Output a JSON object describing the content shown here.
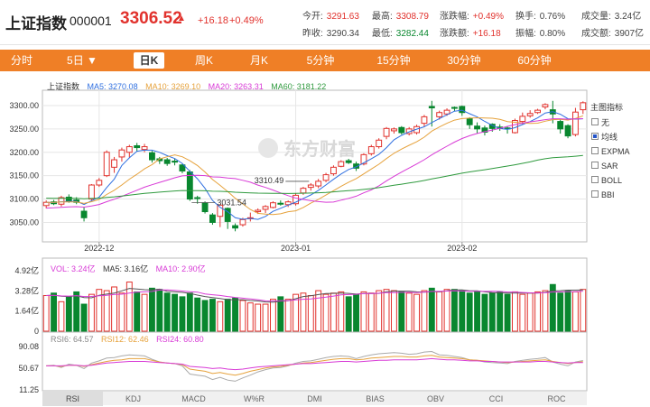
{
  "index": {
    "name": "上证指数",
    "code": "000001",
    "price": "3306.52",
    "arrow": "▲",
    "change": "+16.18",
    "change_pct": "+0.49%"
  },
  "stats": [
    {
      "label": "今开:",
      "value": "3291.63",
      "color": "red"
    },
    {
      "label": "最高:",
      "value": "3308.79",
      "color": "red"
    },
    {
      "label": "涨跌幅:",
      "value": "+0.49%",
      "color": "red"
    },
    {
      "label": "换手:",
      "value": "0.76%",
      "color": "gray"
    },
    {
      "label": "成交量:",
      "value": "3.24亿",
      "color": "gray"
    },
    {
      "label": "昨收:",
      "value": "3290.34",
      "color": "gray"
    },
    {
      "label": "最低:",
      "value": "3282.44",
      "color": "green"
    },
    {
      "label": "涨跌额:",
      "value": "+16.18",
      "color": "red"
    },
    {
      "label": "振幅:",
      "value": "0.80%",
      "color": "gray"
    },
    {
      "label": "成交额:",
      "value": "3907亿",
      "color": "gray"
    }
  ],
  "tabs": [
    "分时",
    "5日 ▼",
    "日K",
    "周K",
    "月K",
    "5分钟",
    "15分钟",
    "30分钟",
    "60分钟"
  ],
  "active_tab": "日K",
  "main_legend": {
    "name": "上证指数",
    "ma5": "MA5: 3270.08",
    "ma10": "MA10: 3269.10",
    "ma20": "MA20: 3263.31",
    "ma60": "MA60: 3181.22"
  },
  "indicator_panel": {
    "title": "主图指标",
    "items": [
      {
        "label": "无",
        "checked": false
      },
      {
        "label": "均线",
        "checked": true
      },
      {
        "label": "EXPMA",
        "checked": false
      },
      {
        "label": "SAR",
        "checked": false
      },
      {
        "label": "BOLL",
        "checked": false
      },
      {
        "label": "BBI",
        "checked": false
      }
    ]
  },
  "volume_legend": {
    "vol": "VOL: 3.24亿",
    "ma5": "MA5: 3.16亿",
    "ma10": "MA10: 2.90亿"
  },
  "rsi_legend": {
    "rsi6": "RSI6: 64.57",
    "rsi12": "RSI12: 62.46",
    "rsi24": "RSI24: 60.80"
  },
  "bottom_tabs": [
    "RSI",
    "KDJ",
    "MACD",
    "W%R",
    "DMI",
    "BIAS",
    "OBV",
    "CCI",
    "ROC"
  ],
  "active_bottom_tab": "RSI",
  "watermark": "东方财富",
  "colors": {
    "up": "#e1322d",
    "down": "#09872f",
    "ma5": "#2f6fe0",
    "ma10": "#e6a23c",
    "ma20": "#d83ad6",
    "ma60": "#2f9a3e",
    "tab_bar": "#ef7f26"
  },
  "chart_data": [
    {
      "type": "candlestick",
      "title": "上证指数",
      "y_ticks": [
        "3300.00",
        "3250.00",
        "3200.00",
        "3150.00",
        "3100.00",
        "3050.00"
      ],
      "ylim": [
        3020,
        3325
      ],
      "x_ticks": [
        "2022-12",
        "2023-01",
        "2023-02"
      ],
      "annotations": [
        {
          "label": "3310.49",
          "type": "high",
          "index": 35
        },
        {
          "label": "3031.54",
          "type": "low",
          "index": 19
        }
      ],
      "candles": [
        [
          3086,
          3093,
          3080,
          3097
        ],
        [
          3094,
          3090,
          3087,
          3098
        ],
        [
          3089,
          3103,
          3084,
          3107
        ],
        [
          3104,
          3096,
          3092,
          3110
        ],
        [
          3098,
          3093,
          3089,
          3104
        ],
        [
          3074,
          3060,
          3052,
          3082
        ],
        [
          3100,
          3130,
          3096,
          3132
        ],
        [
          3130,
          3140,
          3126,
          3145
        ],
        [
          3150,
          3200,
          3147,
          3204
        ],
        [
          3168,
          3184,
          3156,
          3190
        ],
        [
          3190,
          3205,
          3180,
          3210
        ],
        [
          3200,
          3212,
          3189,
          3216
        ],
        [
          3214,
          3210,
          3202,
          3220
        ],
        [
          3206,
          3212,
          3200,
          3218
        ],
        [
          3199,
          3184,
          3178,
          3203
        ],
        [
          3186,
          3182,
          3175,
          3190
        ],
        [
          3184,
          3176,
          3171,
          3188
        ],
        [
          3181,
          3179,
          3172,
          3187
        ],
        [
          3173,
          3160,
          3155,
          3175
        ],
        [
          3158,
          3100,
          3096,
          3162
        ],
        [
          3103,
          3102,
          3090,
          3107
        ],
        [
          3092,
          3073,
          3069,
          3095
        ],
        [
          3066,
          3050,
          3045,
          3070
        ],
        [
          3063,
          3087,
          3040,
          3089
        ],
        [
          3080,
          3052,
          3036,
          3082
        ],
        [
          3043,
          3038,
          3031,
          3048
        ],
        [
          3045,
          3056,
          3041,
          3060
        ],
        [
          3058,
          3060,
          3052,
          3071
        ],
        [
          3073,
          3076,
          3068,
          3080
        ],
        [
          3078,
          3084,
          3070,
          3087
        ],
        [
          3082,
          3092,
          3080,
          3095
        ],
        [
          3091,
          3089,
          3086,
          3097
        ],
        [
          3088,
          3094,
          3083,
          3097
        ],
        [
          3090,
          3108,
          3086,
          3112
        ],
        [
          3113,
          3123,
          3109,
          3126
        ],
        [
          3125,
          3130,
          3118,
          3134
        ],
        [
          3128,
          3138,
          3123,
          3143
        ],
        [
          3140,
          3152,
          3136,
          3156
        ],
        [
          3154,
          3168,
          3150,
          3172
        ],
        [
          3170,
          3180,
          3168,
          3183
        ],
        [
          3182,
          3178,
          3175,
          3186
        ],
        [
          3175,
          3166,
          3160,
          3180
        ],
        [
          3175,
          3195,
          3172,
          3198
        ],
        [
          3197,
          3212,
          3193,
          3216
        ],
        [
          3212,
          3226,
          3208,
          3230
        ],
        [
          3234,
          3251,
          3228,
          3254
        ],
        [
          3246,
          3250,
          3240,
          3253
        ],
        [
          3253,
          3242,
          3238,
          3256
        ],
        [
          3240,
          3250,
          3236,
          3254
        ],
        [
          3242,
          3255,
          3238,
          3259
        ],
        [
          3262,
          3276,
          3255,
          3280
        ],
        [
          3298,
          3295,
          3255,
          3310
        ],
        [
          3276,
          3285,
          3270,
          3289
        ],
        [
          3282,
          3290,
          3278,
          3294
        ],
        [
          3296,
          3294,
          3288,
          3298
        ],
        [
          3298,
          3285,
          3278,
          3300
        ],
        [
          3272,
          3259,
          3250,
          3275
        ],
        [
          3256,
          3250,
          3240,
          3264
        ],
        [
          3252,
          3243,
          3236,
          3257
        ],
        [
          3260,
          3251,
          3244,
          3262
        ],
        [
          3254,
          3251,
          3246,
          3260
        ],
        [
          3252,
          3250,
          3240,
          3255
        ],
        [
          3242,
          3268,
          3240,
          3272
        ],
        [
          3266,
          3277,
          3260,
          3285
        ],
        [
          3278,
          3283,
          3274,
          3290
        ],
        [
          3285,
          3290,
          3282,
          3293
        ],
        [
          3297,
          3302,
          3292,
          3305
        ],
        [
          3291,
          3282,
          3262,
          3310
        ],
        [
          3266,
          3250,
          3240,
          3272
        ],
        [
          3257,
          3235,
          3230,
          3260
        ],
        [
          3238,
          3286,
          3234,
          3295
        ],
        [
          3291,
          3306,
          3282,
          3309
        ]
      ]
    },
    {
      "type": "bar",
      "title": "VOL",
      "y_ticks": [
        "4.92亿",
        "3.28亿",
        "1.64亿",
        "0"
      ],
      "ylim": [
        0,
        4.92
      ],
      "values": [
        2.9,
        3.1,
        2.4,
        2.8,
        3.2,
        2.2,
        3.0,
        3.4,
        3.3,
        3.6,
        3.1,
        4.0,
        3.2,
        3.0,
        3.5,
        3.4,
        3.1,
        3.0,
        2.8,
        3.1,
        2.7,
        2.5,
        2.6,
        2.4,
        2.6,
        2.7,
        2.5,
        2.3,
        2.2,
        2.2,
        2.6,
        2.8,
        2.6,
        3.0,
        3.1,
        2.9,
        3.3,
        3.0,
        3.1,
        3.2,
        2.8,
        3.0,
        3.2,
        3.1,
        3.3,
        3.4,
        3.3,
        3.2,
        3.1,
        3.0,
        3.3,
        3.5,
        3.2,
        3.4,
        3.4,
        3.3,
        3.1,
        3.2,
        3.0,
        3.1,
        3.2,
        3.0,
        3.2,
        3.0,
        3.1,
        3.2,
        3.3,
        3.8,
        3.1,
        3.3,
        3.2,
        3.4
      ]
    },
    {
      "type": "line",
      "title": "RSI",
      "y_ticks": [
        "90.08",
        "50.67",
        "11.25"
      ],
      "ylim": [
        11.25,
        90.08
      ],
      "series": [
        {
          "name": "RSI6",
          "values": [
            55,
            56,
            52,
            58,
            56,
            50,
            60,
            64,
            69,
            70,
            73,
            75,
            74,
            73,
            67,
            62,
            60,
            59,
            55,
            40,
            38,
            36,
            30,
            34,
            29,
            27,
            33,
            38,
            44,
            48,
            51,
            52,
            55,
            60,
            63,
            64,
            67,
            70,
            72,
            73,
            72,
            68,
            72,
            75,
            77,
            78,
            79,
            78,
            76,
            77,
            80,
            81,
            75,
            74,
            72,
            70,
            66,
            65,
            62,
            61,
            60,
            59,
            63,
            65,
            67,
            68,
            70,
            62,
            58,
            55,
            62,
            64.57
          ]
        },
        {
          "name": "RSI12",
          "values": [
            55,
            55,
            54,
            56,
            56,
            54,
            57,
            60,
            63,
            65,
            66,
            68,
            68,
            68,
            65,
            62,
            60,
            59,
            57,
            49,
            47,
            45,
            41,
            43,
            40,
            38,
            41,
            45,
            48,
            51,
            53,
            54,
            56,
            58,
            60,
            61,
            63,
            65,
            67,
            68,
            68,
            66,
            67,
            69,
            70,
            71,
            72,
            72,
            71,
            71,
            73,
            74,
            71,
            70,
            69,
            68,
            66,
            65,
            64,
            63,
            62,
            61,
            62,
            63,
            64,
            65,
            66,
            63,
            61,
            59,
            61,
            62.46
          ]
        },
        {
          "name": "RSI24",
          "values": [
            55,
            55,
            55,
            56,
            56,
            55,
            56,
            58,
            60,
            61,
            62,
            63,
            63,
            63,
            62,
            61,
            60,
            59,
            58,
            54,
            53,
            52,
            50,
            51,
            49,
            48,
            49,
            51,
            53,
            54,
            55,
            56,
            57,
            58,
            59,
            59,
            60,
            61,
            62,
            63,
            63,
            62,
            63,
            64,
            65,
            65,
            66,
            66,
            66,
            66,
            67,
            68,
            67,
            66,
            66,
            65,
            64,
            64,
            63,
            63,
            62,
            62,
            62,
            62,
            62,
            63,
            63,
            62,
            61,
            60,
            61,
            60.8
          ]
        }
      ]
    }
  ]
}
